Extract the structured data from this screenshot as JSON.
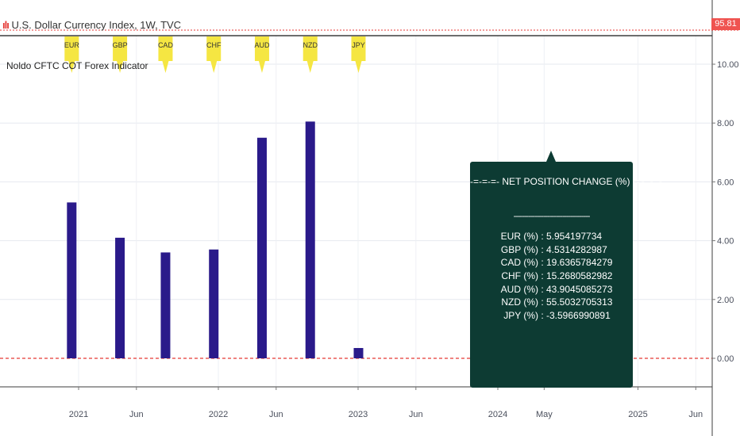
{
  "header": {
    "symbol_title": "U.S. Dollar Currency Index, 1W, TVC",
    "indicator_name": "Noldo CFTC COT Forex Indicator",
    "price_badge": "95.81"
  },
  "colors": {
    "bar": "#2a1a8a",
    "zero_line": "#e53935",
    "table_bg": "#0d3b33",
    "flag": "#f5e642",
    "price_line": "#e53935"
  },
  "net_table": {
    "title": "-=-=-=- NET POSITION CHANGE (%) -=-=-=-",
    "separator": "------------------------------------",
    "rows": [
      {
        "currency": "EUR (%)",
        "value": "5.954197734"
      },
      {
        "currency": "GBP (%)",
        "value": "4.5314282987"
      },
      {
        "currency": "CAD (%)",
        "value": "19.6365784279"
      },
      {
        "currency": "CHF (%)",
        "value": "15.2680582982"
      },
      {
        "currency": "AUD (%)",
        "value": "43.9045085273"
      },
      {
        "currency": "NZD (%)",
        "value": "55.5032705313"
      },
      {
        "currency": "JPY (%)",
        "value": "-3.5966990891"
      }
    ]
  },
  "chart_data": {
    "type": "bar",
    "categories": [
      "EUR",
      "GBP",
      "CAD",
      "CHF",
      "AUD",
      "NZD",
      "JPY"
    ],
    "values": [
      5.3,
      4.1,
      3.6,
      3.7,
      7.5,
      8.05,
      0.35
    ],
    "bar_dates": [
      "2020-12-14",
      "2021-04-19",
      "2021-08-16",
      "2021-12-20",
      "2022-04-25",
      "2022-08-29",
      "2023-01-02"
    ],
    "x_ticks": [
      {
        "label": "2021",
        "date": "2021-01-01"
      },
      {
        "label": "Jun",
        "date": "2021-06-01"
      },
      {
        "label": "2022",
        "date": "2022-01-01"
      },
      {
        "label": "Jun",
        "date": "2022-06-01"
      },
      {
        "label": "2023",
        "date": "2023-01-01"
      },
      {
        "label": "Jun",
        "date": "2023-06-01"
      },
      {
        "label": "2024",
        "date": "2024-01-01"
      },
      {
        "label": "May",
        "date": "2024-05-01"
      },
      {
        "label": "2025",
        "date": "2025-01-01"
      },
      {
        "label": "Jun",
        "date": "2025-06-01"
      }
    ],
    "y_ticks": [
      "0.00",
      "2.00",
      "4.00",
      "6.00",
      "8.00",
      "10.00"
    ],
    "ylim": [
      -0.6,
      10.9
    ],
    "grid": true,
    "zero_line": "dashed"
  }
}
